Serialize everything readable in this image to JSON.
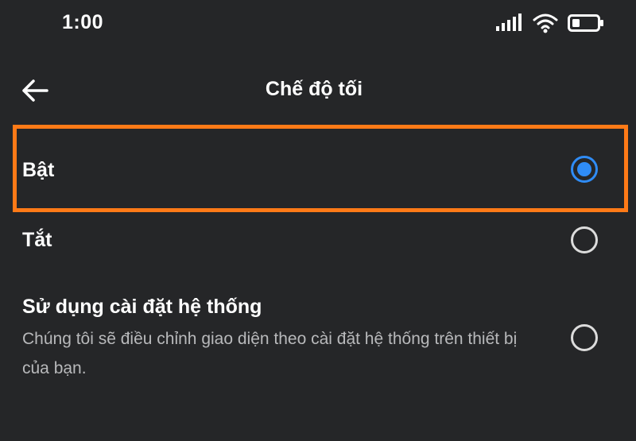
{
  "status_bar": {
    "time": "1:00",
    "icons": [
      "signal-icon",
      "wifi-icon",
      "battery-icon"
    ]
  },
  "header": {
    "back_icon": "arrow-left-icon",
    "title": "Chế độ tối"
  },
  "options": [
    {
      "label": "Bật",
      "selected": true
    },
    {
      "label": "Tắt",
      "selected": false
    },
    {
      "label": "Sử dụng cài đặt hệ thống",
      "description": "Chúng tôi sẽ điều chỉnh giao diện theo cài đặt hệ thống trên thiết bị của bạn.",
      "selected": false
    }
  ],
  "colors": {
    "background": "#252628",
    "accent": "#2f8cf6",
    "highlight": "#ff7a17"
  }
}
